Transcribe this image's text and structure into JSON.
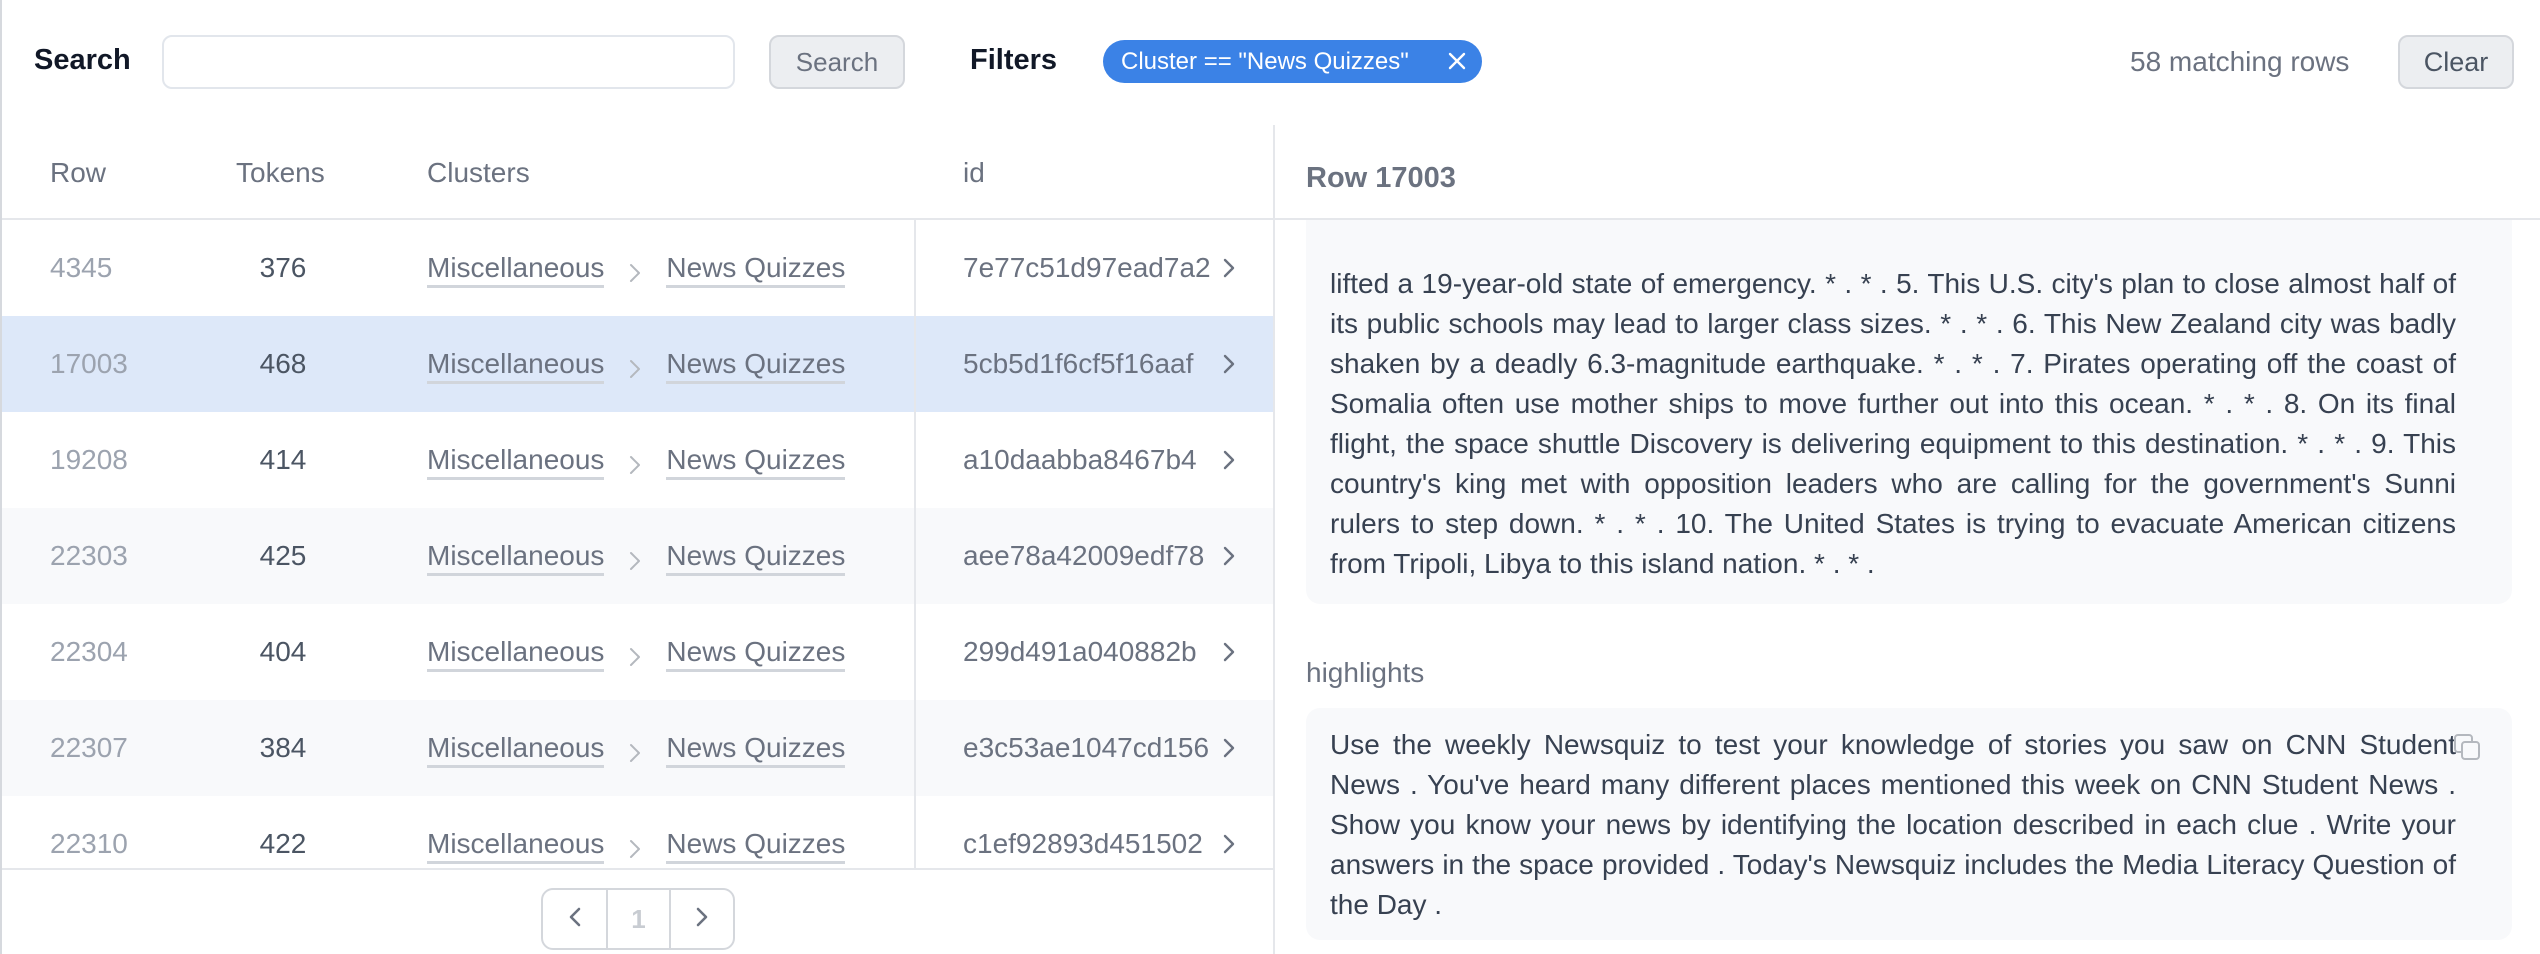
{
  "topbar": {
    "search_label": "Search",
    "search_value": "",
    "search_placeholder": "",
    "search_button": "Search",
    "filters_label": "Filters",
    "filter_chip": "Cluster == \"News Quizzes\"",
    "filter_chip_close_icon": "close-icon",
    "match_count": "58 matching rows",
    "clear_button": "Clear"
  },
  "table": {
    "columns": [
      "Row",
      "Tokens",
      "Clusters",
      "id"
    ],
    "rows": [
      {
        "row": "4345",
        "tokens": "376",
        "cluster_parent": "Miscellaneous",
        "cluster_child": "News Quizzes",
        "id": "7e77c51d97ead7a2",
        "selected": false
      },
      {
        "row": "17003",
        "tokens": "468",
        "cluster_parent": "Miscellaneous",
        "cluster_child": "News Quizzes",
        "id": "5cb5d1f6cf5f16aaf",
        "selected": true
      },
      {
        "row": "19208",
        "tokens": "414",
        "cluster_parent": "Miscellaneous",
        "cluster_child": "News Quizzes",
        "id": "a10daabba8467b4",
        "selected": false
      },
      {
        "row": "22303",
        "tokens": "425",
        "cluster_parent": "Miscellaneous",
        "cluster_child": "News Quizzes",
        "id": "aee78a42009edf78",
        "selected": false
      },
      {
        "row": "22304",
        "tokens": "404",
        "cluster_parent": "Miscellaneous",
        "cluster_child": "News Quizzes",
        "id": "299d491a040882b",
        "selected": false
      },
      {
        "row": "22307",
        "tokens": "384",
        "cluster_parent": "Miscellaneous",
        "cluster_child": "News Quizzes",
        "id": "e3c53ae1047cd156",
        "selected": false
      },
      {
        "row": "22310",
        "tokens": "422",
        "cluster_parent": "Miscellaneous",
        "cluster_child": "News Quizzes",
        "id": "c1ef92893d451502",
        "selected": false
      }
    ],
    "pagination": {
      "current_page": "1",
      "prev_icon": "chevron-left-icon",
      "next_icon": "chevron-right-icon"
    }
  },
  "detail": {
    "title": "Row 17003",
    "article_text": "lifted a 19-year-old state of emergency. * . * . 5. This U.S. city's plan to close almost half of its public schools may lead to larger class sizes. * . * . 6. This New Zealand city was badly shaken by a deadly 6.3-magnitude earthquake. * . * . 7. Pirates operating off the coast of Somalia often use mother ships to move further out into this ocean. * . * . 8. On its final flight, the space shuttle Discovery is delivering equipment to this destination. * . * . 9. This country's king met with opposition leaders who are calling for the government's Sunni rulers to step down. * . * . 10. The United States is trying to evacuate American citizens from Tripoli, Libya to this island nation. * . * .",
    "highlights_label": "highlights",
    "highlights_text": "Use the weekly Newsquiz to test your knowledge of stories you saw on CNN Student News . You've heard many different places mentioned this week on CNN Student News . Show you know your news by identifying the location described in each clue . Write your answers in the space provided . Today's Newsquiz includes the Media Literacy Question of the Day .",
    "copy_icon": "copy-icon"
  },
  "colors": {
    "accent": "#3b82e6",
    "selected_row": "#dde8f9",
    "alt_row": "#f8f9fb"
  }
}
